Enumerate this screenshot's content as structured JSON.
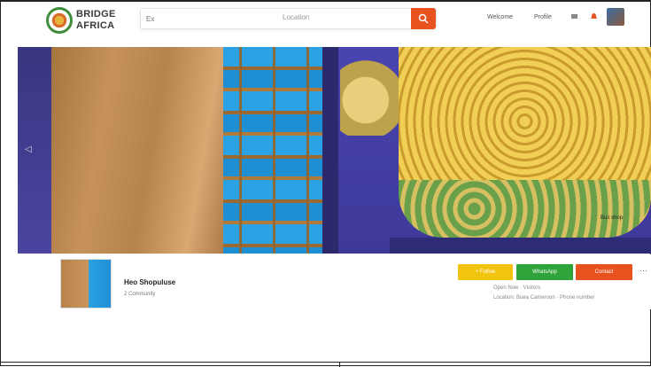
{
  "header": {
    "logo_line1": "BRIDGE",
    "logo_line2": "AFRICA",
    "search_placeholder": "Ex",
    "search_location": "Location",
    "nav_about": "Welcome",
    "nav_shop": "Profile"
  },
  "banner": {
    "arrow": "◁",
    "corner_label": "Bus shop"
  },
  "profile": {
    "shop_name": "Heo Shopuluse",
    "shop_sub": "2 Community",
    "follow_label": "+ Follow",
    "whatsapp_label": "WhatsApp",
    "contact_label": "Contact",
    "more": "···",
    "meta_line1": "Open Now · Visitors",
    "meta_line2": "Location: Buea Cameroon · Phone number"
  },
  "colors": {
    "accent": "#e8521f",
    "follow": "#f2c40f",
    "whatsapp": "#2fa43a"
  }
}
